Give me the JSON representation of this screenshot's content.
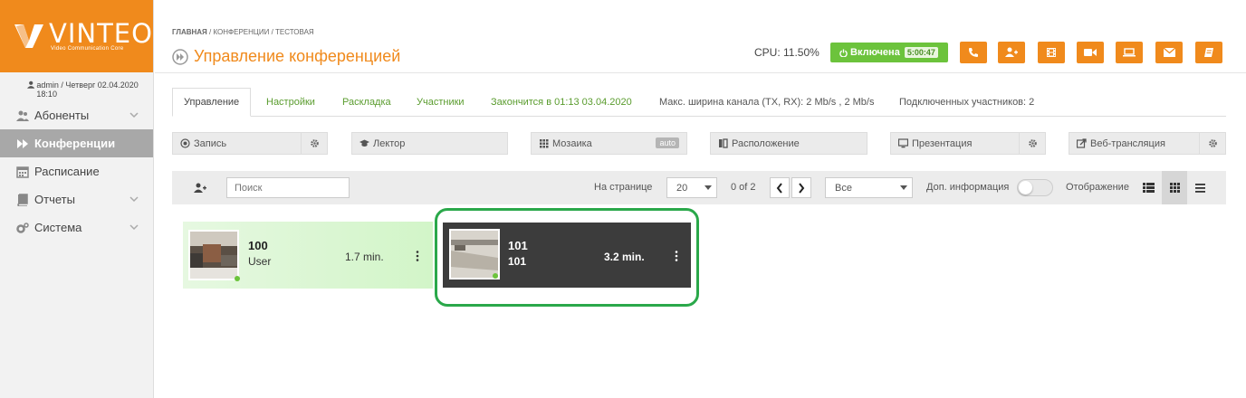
{
  "brand": {
    "title": "VINTEO",
    "subtitle": "Video Communication Core",
    "color": "#f08a1c"
  },
  "user": {
    "line": "admin / Четверг 02.04.2020 18:10"
  },
  "sidebar": {
    "items": [
      {
        "label": "Абоненты",
        "icon": "users-icon",
        "has_chevron": true,
        "active": false
      },
      {
        "label": "Конференции",
        "icon": "forward-icon",
        "has_chevron": false,
        "active": true
      },
      {
        "label": "Расписание",
        "icon": "calendar-icon",
        "has_chevron": false,
        "active": false
      },
      {
        "label": "Отчеты",
        "icon": "book-icon",
        "has_chevron": true,
        "active": false
      },
      {
        "label": "Система",
        "icon": "cogs-icon",
        "has_chevron": true,
        "active": false
      }
    ]
  },
  "breadcrumb": {
    "home": "ГЛАВНАЯ",
    "sep1": " / ",
    "section": "КОНФЕРЕНЦИИ",
    "sep2": " / ",
    "current": "ТЕСТОВАЯ"
  },
  "header": {
    "title": "Управление конференцией",
    "cpu": "CPU: 11.50%",
    "status_label": "Включена",
    "status_timer": "5:00:47",
    "status_color": "#6cc33c",
    "tools": [
      "phone-icon",
      "add-user-icon",
      "film-icon",
      "video-camera-icon",
      "laptop-icon",
      "envelope-icon",
      "notebook-icon"
    ]
  },
  "tabs": {
    "items": [
      "Управление",
      "Настройки",
      "Раскладка",
      "Участники"
    ],
    "ends_at": "Закончится в 01:13 03.04.2020",
    "bandwidth": "Макс. ширина канала (TX, RX): 2 Mb/s , 2 Mb/s",
    "connected": "Подключенных участников: 2"
  },
  "actions": {
    "record": "Запись",
    "lector": "Лектор",
    "mosaic": "Мозаика",
    "mosaic_badge": "auto",
    "layout": "Расположение",
    "presentation": "Презентация",
    "webcast": "Веб-трансляция"
  },
  "toolbar": {
    "search_placeholder": "Поиск",
    "per_page_label": "На странице",
    "per_page_value": "20",
    "page_info": "0 of 2",
    "filter_value": "Все",
    "extra_info_label": "Доп. информация",
    "extra_info_on": false,
    "display_label": "Отображение",
    "view_modes": [
      "list-icon",
      "grid-icon",
      "lines-icon"
    ],
    "active_view": "grid-icon"
  },
  "participants": [
    {
      "name": "100",
      "sub": "User",
      "time": "1.7 min.",
      "status": "online",
      "style": "green"
    },
    {
      "name": "101",
      "sub": "101",
      "time": "3.2 min.",
      "status": "online",
      "style": "dark",
      "highlighted": true
    }
  ]
}
